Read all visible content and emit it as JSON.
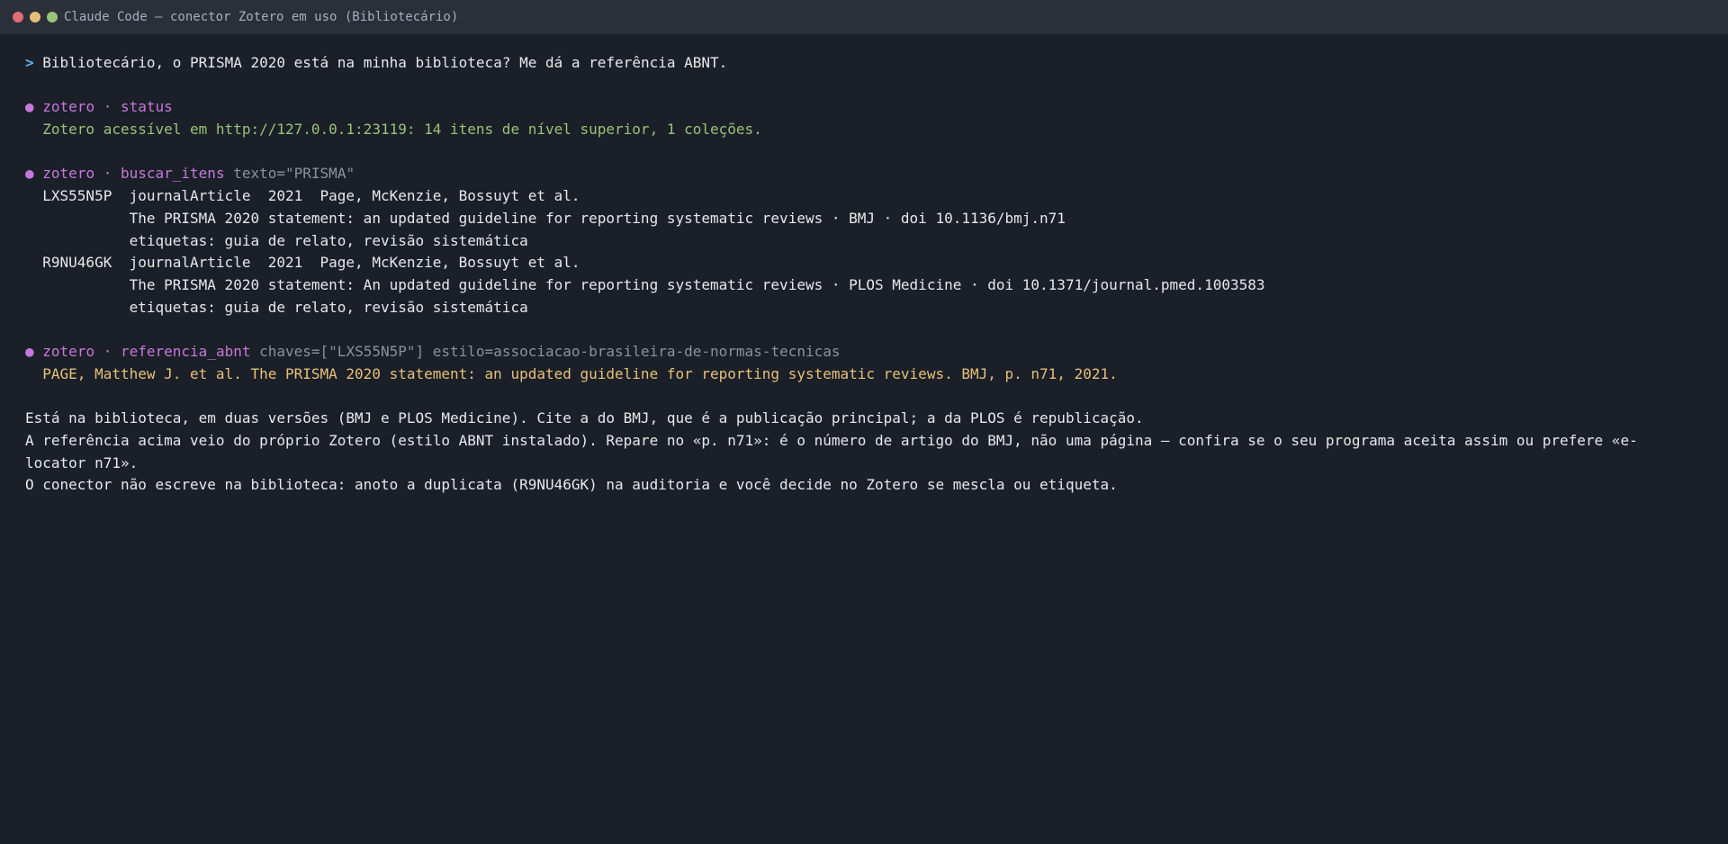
{
  "window": {
    "title": "Claude Code — conector Zotero em uso (Bibliotecário)"
  },
  "user_prompt": {
    "marker": ">",
    "text": "Bibliotecário, o PRISMA 2020 está na minha biblioteca? Me dá a referência ABNT."
  },
  "calls": {
    "status": {
      "bullet": "●",
      "name": "zotero · status",
      "args": "",
      "output": "Zotero acessível em http://127.0.0.1:23119: 14 itens de nível superior, 1 coleções."
    },
    "search": {
      "bullet": "●",
      "name": "zotero · buscar_itens",
      "args": "texto=\"PRISMA\"",
      "results": [
        {
          "header": "LXS55N5P  journalArticle  2021  Page, McKenzie, Bossuyt et al.",
          "title": "The PRISMA 2020 statement: an updated guideline for reporting systematic reviews · BMJ · doi 10.1136/bmj.n71",
          "tags": "etiquetas: guia de relato, revisão sistemática"
        },
        {
          "header": "R9NU46GK  journalArticle  2021  Page, McKenzie, Bossuyt et al.",
          "title": "The PRISMA 2020 statement: An updated guideline for reporting systematic reviews · PLOS Medicine · doi 10.1371/journal.pmed.1003583",
          "tags": "etiquetas: guia de relato, revisão sistemática"
        }
      ]
    },
    "abnt": {
      "bullet": "●",
      "name": "zotero · referencia_abnt",
      "args": "chaves=[\"LXS55N5P\"] estilo=associacao-brasileira-de-normas-tecnicas",
      "output": "PAGE, Matthew J. et al. The PRISMA 2020 statement: an updated guideline for reporting systematic reviews. BMJ, p. n71, 2021."
    }
  },
  "answer": {
    "line1": "Está na biblioteca, em duas versões (BMJ e PLOS Medicine). Cite a do BMJ, que é a publicação principal; a da PLOS é republicação.",
    "line2a": "A referência acima veio do próprio Zotero (estilo ABNT instalado). Repare no «p. n71»: é o número de artigo do BMJ, não uma página — confira se o seu programa aceita assim ou prefere «e-",
    "line2b": "locator n71».",
    "line3": "O conector não escreve na biblioteca: anoto a duplicata (R9NU46GK) na auditoria e você decide no Zotero se mescla ou etiqueta."
  },
  "colors": {
    "background": "#1b1f27",
    "titlebar": "#2b2f3a",
    "tool": "#c678dd",
    "ok": "#98c379",
    "reference": "#e5c07b",
    "prompt": "#61afef"
  }
}
